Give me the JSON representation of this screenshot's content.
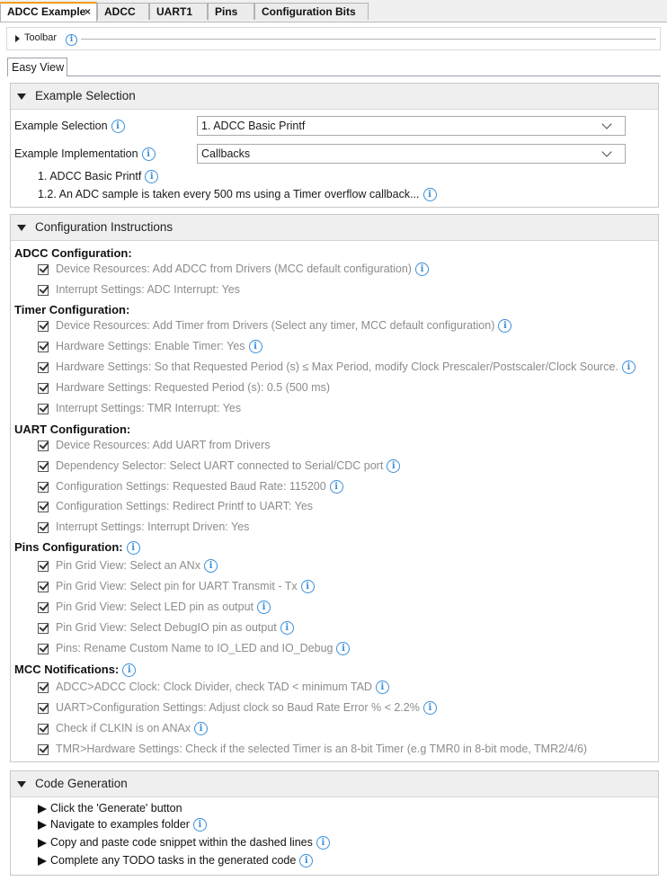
{
  "tabs": [
    {
      "label": "ADCC Example",
      "active": true,
      "close": "×"
    },
    {
      "label": "ADCC"
    },
    {
      "label": "UART1"
    },
    {
      "label": "Pins"
    },
    {
      "label": "Configuration Bits"
    }
  ],
  "toolbar": {
    "label": "Toolbar"
  },
  "view_tab": "Easy View",
  "example_selection": {
    "title": "Example Selection",
    "selection_label": "Example Selection",
    "selection_value": "1. ADCC Basic Printf",
    "implementation_label": "Example Implementation",
    "implementation_value": "Callbacks",
    "desc_title": "1. ADCC Basic Printf",
    "desc_text": "1.2. An ADC sample is taken every 500 ms using a Timer overflow callback..."
  },
  "config": {
    "title": "Configuration Instructions",
    "adcc": {
      "heading": "ADCC Configuration:",
      "items": [
        "Device Resources: Add ADCC from Drivers (MCC default configuration)",
        "Interrupt Settings: ADC Interrupt: Yes"
      ]
    },
    "timer": {
      "heading": "Timer Configuration:",
      "items": [
        "Device Resources: Add Timer from Drivers (Select any timer, MCC default configuration)",
        "Hardware Settings: Enable Timer: Yes",
        "Hardware Settings: So that Requested Period (s) ≤ Max Period, modify Clock Prescaler/Postscaler/Clock Source.",
        "Hardware Settings: Requested Period (s): 0.5 (500 ms)",
        "Interrupt Settings: TMR Interrupt: Yes"
      ]
    },
    "uart": {
      "heading": "UART Configuration:",
      "items": [
        "Device Resources: Add UART from Drivers",
        "Dependency Selector: Select UART connected to Serial/CDC port",
        "Configuration Settings: Requested Baud Rate: 115200",
        "Configuration Settings: Redirect Printf to UART: Yes",
        "Interrupt Settings: Interrupt Driven: Yes"
      ]
    },
    "pins": {
      "heading": "Pins Configuration:",
      "items": [
        "Pin Grid View: Select an ANx",
        "Pin Grid View: Select pin for UART Transmit - Tx",
        "Pin Grid View: Select LED pin as output",
        "Pin Grid View: Select DebugIO pin as output",
        "Pins: Rename Custom Name to IO_LED and IO_Debug"
      ]
    },
    "mcc": {
      "heading": "MCC Notifications:",
      "items": [
        "ADCC>ADCC Clock: Clock Divider, check TAD < minimum TAD",
        "UART>Configuration Settings: Adjust clock so Baud Rate Error % < 2.2%",
        "Check if CLKIN is on ANAx",
        "TMR>Hardware Settings: Check if the selected Timer is an 8-bit Timer (e.g TMR0 in 8-bit mode, TMR2/4/6)"
      ]
    }
  },
  "codegen": {
    "title": "Code Generation",
    "steps": [
      "Click the 'Generate' button",
      "Navigate to examples folder",
      "Copy and paste code snippet within the dashed lines",
      "Complete any TODO tasks in the generated code"
    ]
  },
  "icons": {
    "info": "info-icon",
    "check": "checkbox-checked-icon",
    "arrow": "arrow-right-icon",
    "collapse": "triangle-down-icon"
  },
  "colors": {
    "tab_accent": "#f29b1d",
    "info_blue": "#3a8fd9",
    "muted_text": "#8c8c8c"
  }
}
